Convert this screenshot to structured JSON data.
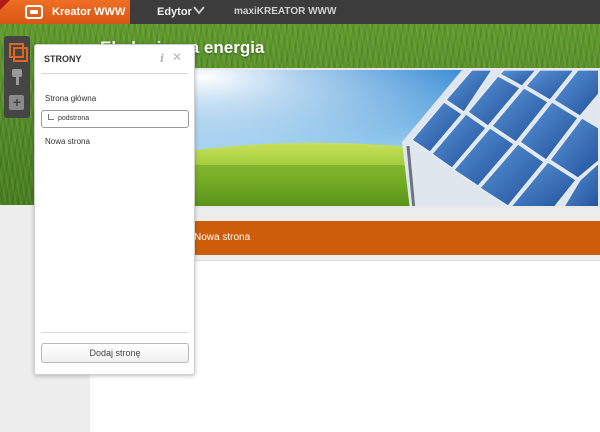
{
  "topbar": {
    "brand": "Kreator WWW",
    "menu_editor": "Edytor",
    "menu_maxi": "maxiKREATOR WWW"
  },
  "site": {
    "title": "Ekologiczna energia",
    "nav_item": "Nowa strona"
  },
  "panel": {
    "title": "STRONY",
    "info_glyph": "i",
    "close_glyph": "✕",
    "pages": [
      {
        "label": "Strona główna"
      },
      {
        "label": "podstrona"
      },
      {
        "label": "Nowa strona"
      }
    ],
    "add_button": "Dodaj stronę"
  },
  "colors": {
    "accent": "#e1661d",
    "nav": "#cd5d0a",
    "topbar": "#3c3c3c"
  },
  "icons": {
    "tool_pages": "pages-icon",
    "tool_style": "brush-icon",
    "tool_add": "add-icon"
  }
}
